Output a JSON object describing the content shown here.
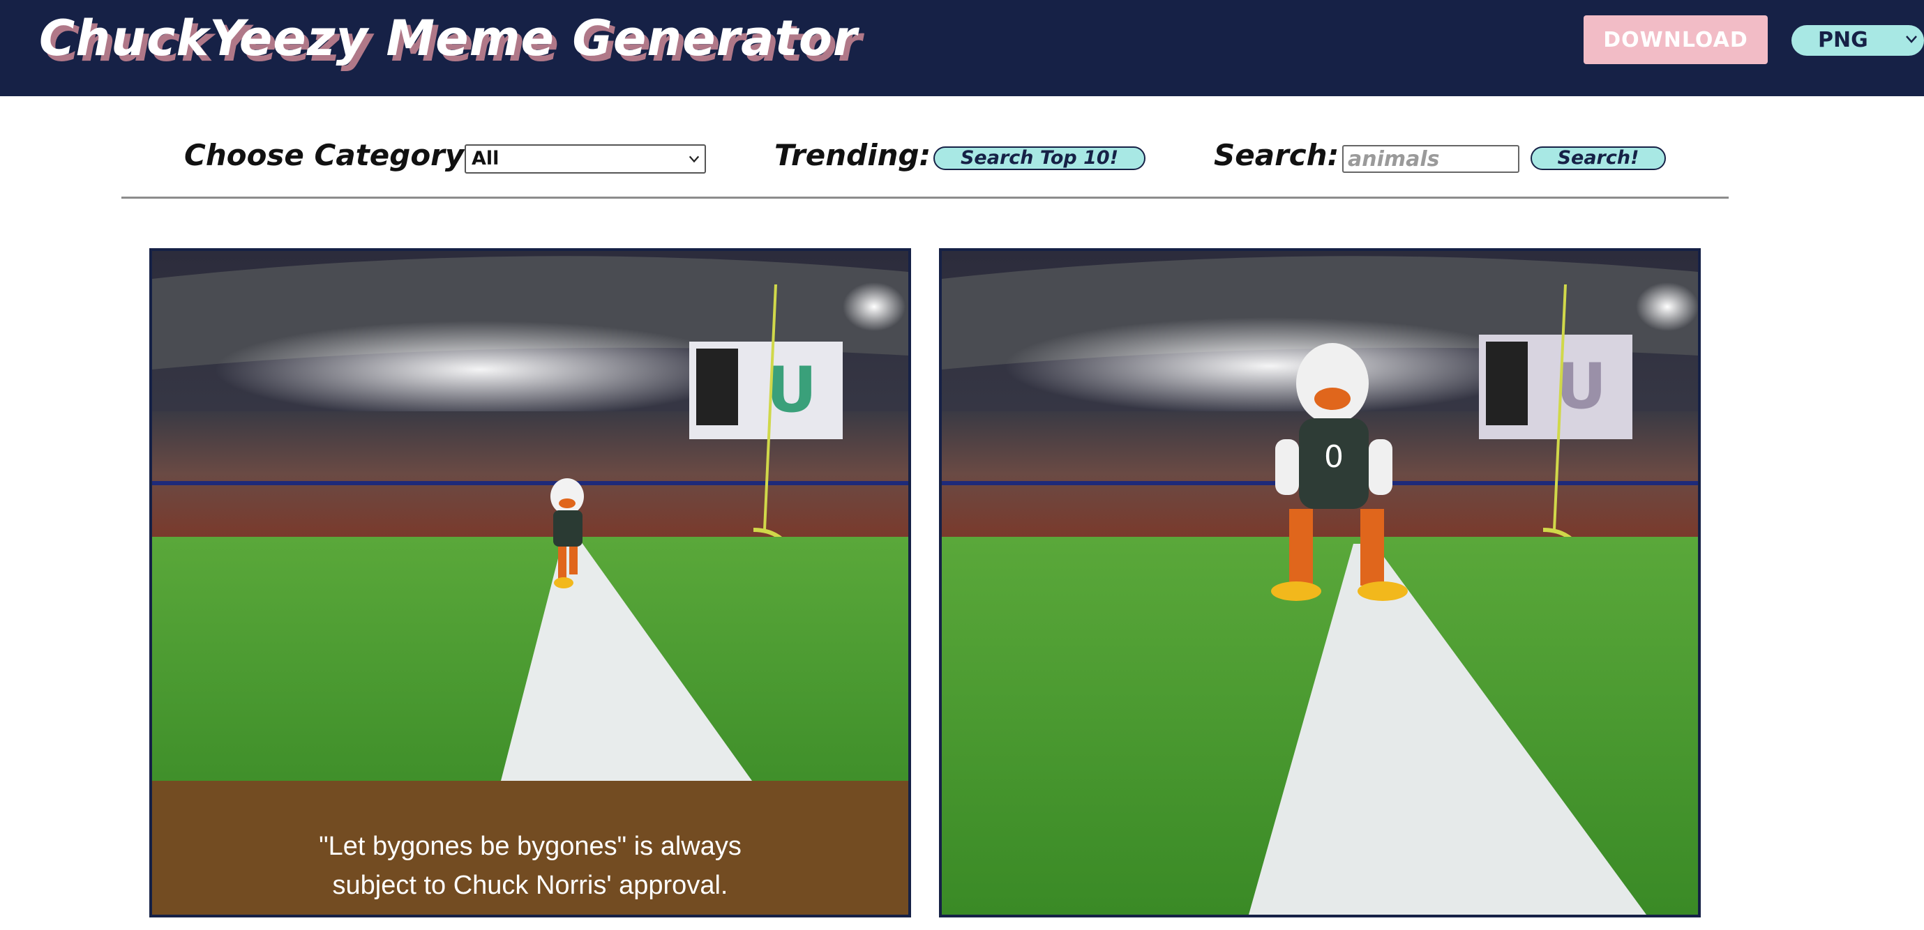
{
  "app": {
    "title": "ChuckYeezy Meme Generator"
  },
  "header": {
    "download_label": "DOWNLOAD",
    "format_selected": "PNG"
  },
  "toolbar": {
    "category_label": "Choose Category:",
    "category_selected": "All",
    "trending_label": "Trending:",
    "trending_button_label": "Search Top 10!",
    "search_label": "Search:",
    "search_placeholder": "animals",
    "search_value": "",
    "search_button_label": "Search!"
  },
  "memes": [
    {
      "caption_line1": "\"Let bygones be bygones\" is always",
      "caption_line2": "subject to Chuck Norris' approval.",
      "scoreboard_text": "U"
    },
    {
      "caption_line1": "",
      "caption_line2": "",
      "scoreboard_text": "U"
    }
  ],
  "colors": {
    "header_bg": "#162146",
    "title_shadow": "#b07888",
    "download_bg": "#f2bcc6",
    "accent_cyan": "#a8e8e4",
    "caption_band": "#734c22",
    "card_border": "#162146"
  },
  "icons": {
    "format_dropdown": "chevron-down-icon",
    "category_dropdown": "chevron-down-icon"
  }
}
